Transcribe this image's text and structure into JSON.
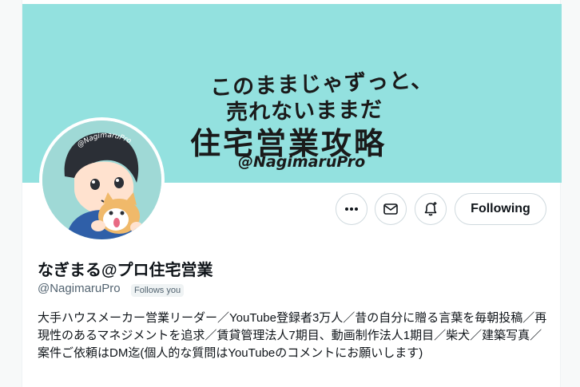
{
  "banner": {
    "line1": "このままじゃずっと、",
    "line2": "売れないままだ",
    "line3": "住宅営業攻略",
    "line4": "@NagimaruPro",
    "bg_color": "#93e1df"
  },
  "avatar": {
    "handle_text": "@NagimaruPro"
  },
  "actions": {
    "more_icon": "more-horizontal-icon",
    "message_icon": "mail-icon",
    "notify_icon": "bell-plus-icon",
    "following_label": "Following"
  },
  "profile": {
    "display_name": "なぎまる@プロ住宅営業",
    "handle": "@NagimaruPro",
    "follows_you": "Follows you",
    "bio": "大手ハウスメーカー営業リーダー／YouTube登録者3万人／昔の自分に贈る言葉を毎朝投稿／再現性のあるマネジメントを追求／賃貸管理法人7期目、動画制作法人1期目／柴犬／建築写真／案件ご依頼はDM迄(個人的な質問はYouTubeのコメントにお願いします)"
  },
  "colors": {
    "text_primary": "#0f1419",
    "text_secondary": "#536471",
    "border": "#cfd9de"
  }
}
